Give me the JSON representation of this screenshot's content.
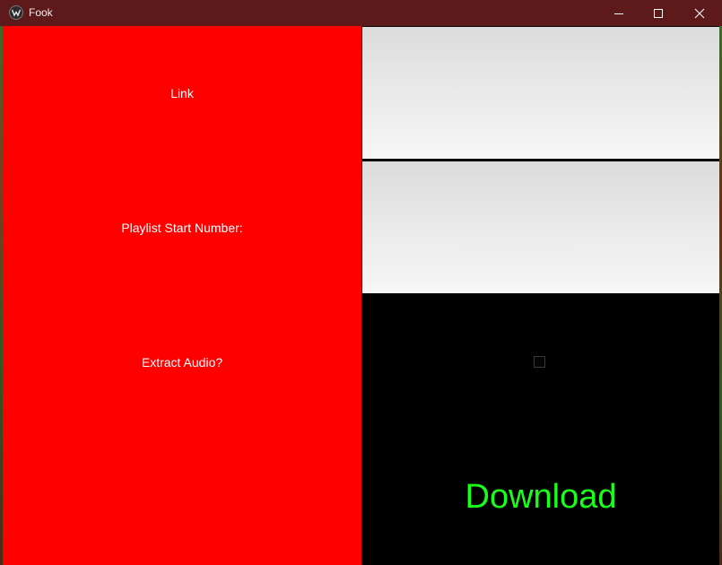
{
  "window": {
    "title": "Fook",
    "controls": [
      "minimize",
      "maximize",
      "close"
    ]
  },
  "form": {
    "link_label": "Link",
    "link_value": "",
    "playlist_label": "Playlist Start Number:",
    "playlist_value": "",
    "extract_audio_label": "Extract Audio?",
    "extract_audio_checked": false,
    "download_label": "Download"
  },
  "colors": {
    "titlebar": "#5e1a1a",
    "label_panel": "#ff0000",
    "download_text": "#1aff1a",
    "background": "#000000"
  },
  "icons": {
    "app": "kivy-app-icon",
    "minimize": "minimize-icon",
    "maximize": "maximize-icon",
    "close": "close-icon",
    "checkbox": "checkbox-icon"
  }
}
